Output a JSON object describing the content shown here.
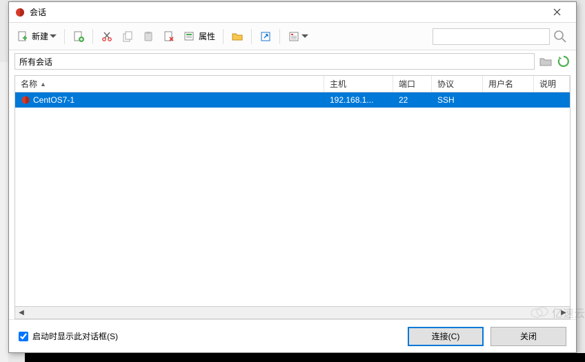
{
  "window": {
    "title": "会话",
    "close_tooltip": "关闭"
  },
  "toolbar": {
    "new_label": "新建",
    "properties_label": "属性"
  },
  "pathbar": {
    "path": "所有会话"
  },
  "columns": {
    "name": "名称",
    "host": "主机",
    "port": "端口",
    "protocol": "协议",
    "user": "用户名",
    "desc": "说明"
  },
  "rows": [
    {
      "name": "CentOS7-1",
      "host": "192.168.1...",
      "port": "22",
      "protocol": "SSH",
      "user": "",
      "desc": ""
    }
  ],
  "footer": {
    "show_on_startup": "启动时显示此对话框(S)",
    "connect": "连接(C)",
    "close": "关闭"
  },
  "search": {
    "placeholder": ""
  },
  "watermark": "亿速云"
}
